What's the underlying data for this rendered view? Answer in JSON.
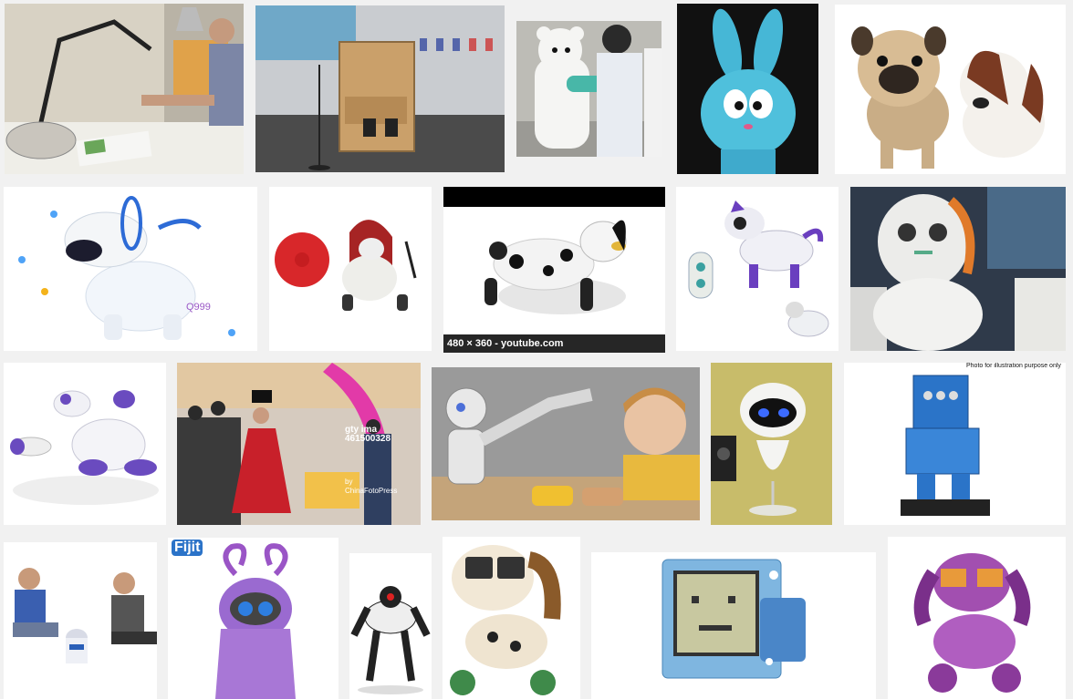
{
  "results": [
    {
      "alt": "robot arm lamp with man at desk"
    },
    {
      "alt": "wooden CNC machine in gallery"
    },
    {
      "alt": "white bear robot hugging man"
    },
    {
      "alt": "blue bunny toy"
    },
    {
      "alt": "two plush puppies"
    },
    {
      "alt": "white and blue robot dog toy",
      "overlay_text": "Q999"
    },
    {
      "alt": "robot dog with red ball and hoodie"
    },
    {
      "alt": "Zoomer dalmatian robot dog",
      "caption": "480 × 360 - youtube.com"
    },
    {
      "alt": "purple robot dog with remote"
    },
    {
      "alt": "white and orange robot head"
    },
    {
      "alt": "purple white robot dog lying"
    },
    {
      "alt": "robot in red dress with crowd",
      "watermark_lines": [
        "gty ima",
        "461500328",
        "by",
        "ChinaFotoPress"
      ]
    },
    {
      "alt": "Nao humanoid robot with boy"
    },
    {
      "alt": "EVE style robot lamp"
    },
    {
      "alt": "blue transparent robot kit",
      "overlay_text": "Photo for illustration purpose only"
    },
    {
      "alt": "kids with R2-D2 toy"
    },
    {
      "alt": "Fijit Friends purple toy",
      "logo_text": "Fijit"
    },
    {
      "alt": "Roboquad robot"
    },
    {
      "alt": "cartoon robot dog with glasses"
    },
    {
      "alt": "blue cube pixel face robot"
    },
    {
      "alt": "purple robot puppy with heart eyes"
    }
  ],
  "colors": {
    "page_bg": "#f1f1f1",
    "caption_bg": "#000000"
  }
}
